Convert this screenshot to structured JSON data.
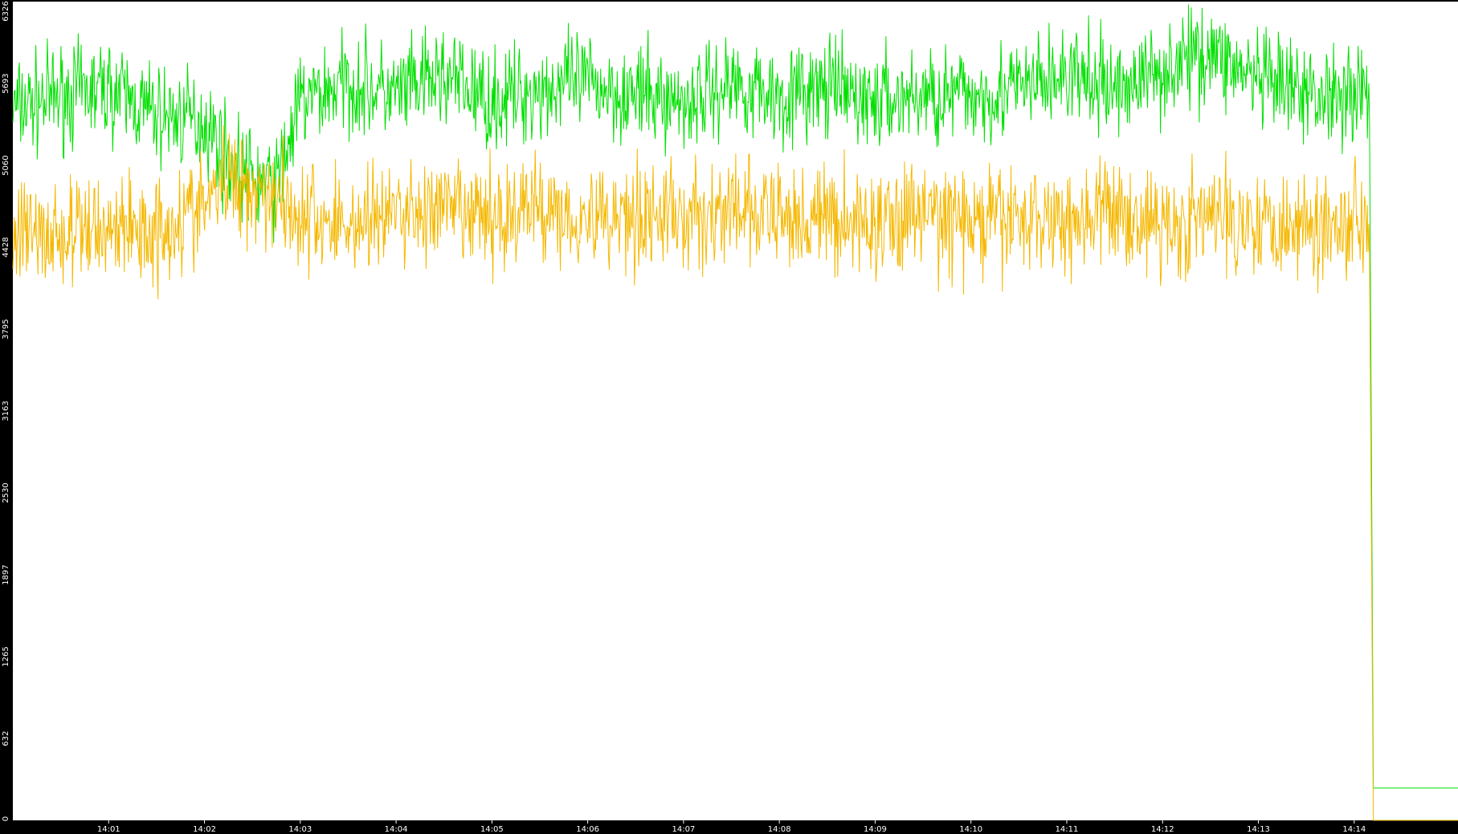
{
  "chart_data": {
    "type": "line",
    "background_color": "#000000",
    "plot_background_color": "#ffffff",
    "tick_label_color": "#ffffff",
    "grid": false,
    "legend": "none",
    "ylim": [
      0,
      6326
    ],
    "yticks": [
      "0",
      "632",
      "1265",
      "1897",
      "2530",
      "3163",
      "3795",
      "4428",
      "5060",
      "5693",
      "6326"
    ],
    "xlim": [
      "14:00:00",
      "14:15:05"
    ],
    "xticks": [
      "14:01",
      "14:02",
      "14:03",
      "14:04",
      "14:05",
      "14:06",
      "14:07",
      "14:08",
      "14:09",
      "14:10",
      "14:11",
      "14:12",
      "14:13",
      "14:14"
    ],
    "x_unit": "time (hh:mm)",
    "series": [
      {
        "color": "#00e000",
        "x": [
          "14:00:00",
          "14:00:30",
          "14:01:00",
          "14:01:30",
          "14:02:00",
          "14:02:15",
          "14:02:30",
          "14:02:45",
          "14:03:00",
          "14:03:30",
          "14:04:00",
          "14:04:30",
          "14:05:00",
          "14:05:30",
          "14:06:00",
          "14:06:30",
          "14:07:00",
          "14:07:30",
          "14:08:00",
          "14:08:30",
          "14:09:00",
          "14:09:30",
          "14:10:00",
          "14:10:30",
          "14:11:00",
          "14:11:30",
          "14:12:00",
          "14:12:30",
          "14:13:00",
          "14:13:30",
          "14:14:00",
          "14:14:10",
          "14:14:12",
          "14:15:05"
        ],
        "values": [
          5500,
          5600,
          5650,
          5450,
          5400,
          5100,
          4950,
          4900,
          5550,
          5700,
          5600,
          5750,
          5550,
          5650,
          5700,
          5600,
          5550,
          5700,
          5600,
          5650,
          5550,
          5600,
          5600,
          5650,
          5750,
          5650,
          5800,
          5950,
          5700,
          5600,
          5650,
          5600,
          250,
          250
        ],
        "noise": 380
      },
      {
        "color": "#f5b800",
        "x": [
          "14:00:00",
          "14:00:30",
          "14:01:00",
          "14:01:30",
          "14:02:00",
          "14:02:15",
          "14:02:30",
          "14:02:45",
          "14:03:00",
          "14:03:30",
          "14:04:00",
          "14:04:30",
          "14:05:00",
          "14:05:30",
          "14:06:00",
          "14:06:30",
          "14:07:00",
          "14:07:30",
          "14:08:00",
          "14:08:30",
          "14:09:00",
          "14:09:30",
          "14:10:00",
          "14:10:30",
          "14:11:00",
          "14:11:30",
          "14:12:00",
          "14:12:30",
          "14:13:00",
          "14:13:30",
          "14:14:00",
          "14:14:10",
          "14:14:12",
          "14:15:05"
        ],
        "values": [
          4550,
          4500,
          4600,
          4550,
          4750,
          4950,
          4900,
          4850,
          4650,
          4600,
          4700,
          4700,
          4650,
          4750,
          4650,
          4700,
          4650,
          4700,
          4650,
          4650,
          4600,
          4700,
          4600,
          4650,
          4650,
          4700,
          4600,
          4650,
          4650,
          4600,
          4650,
          4650,
          0,
          0
        ],
        "noise": 420
      }
    ]
  }
}
